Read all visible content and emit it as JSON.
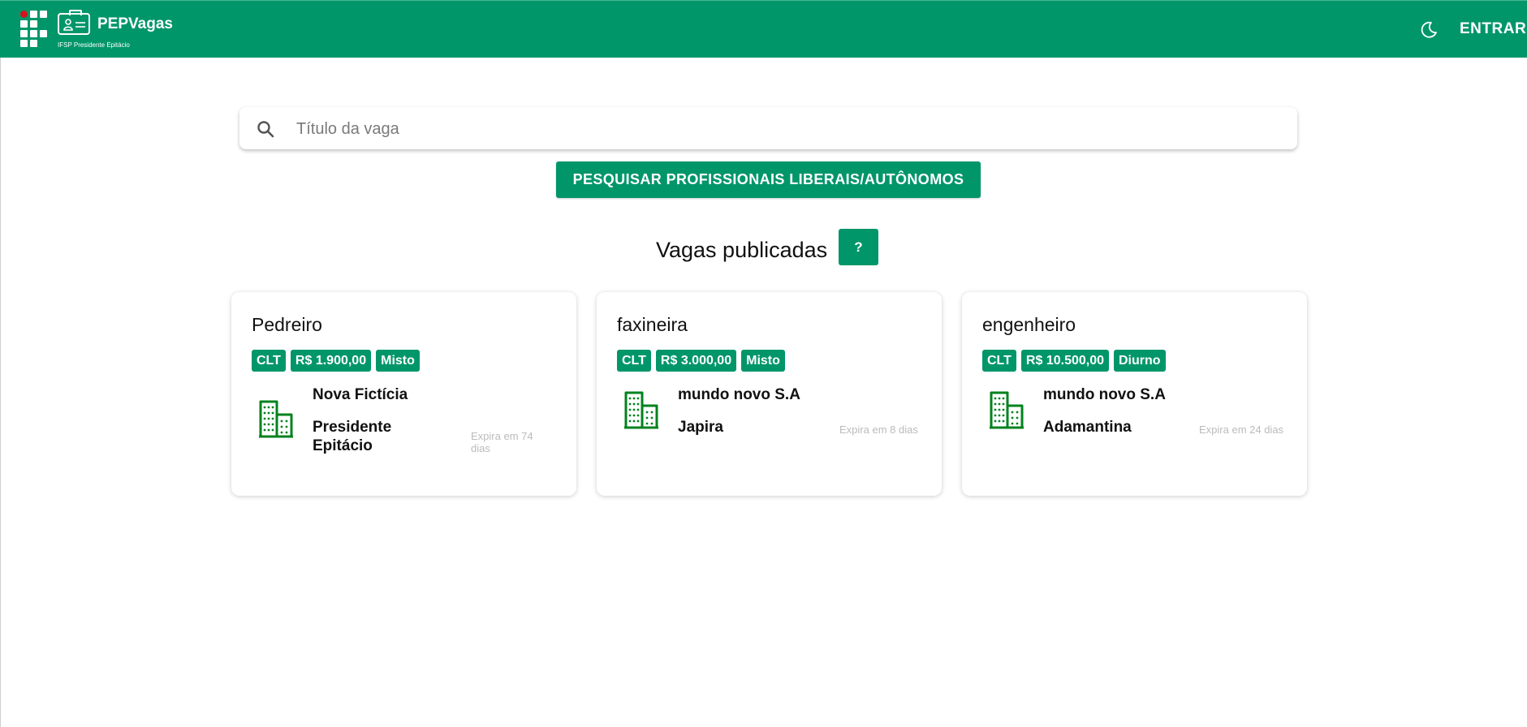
{
  "header": {
    "brand_title": "PEPVagas",
    "brand_subtitle": "IFSP Presidente Epitácio",
    "login_label": "ENTRAR",
    "theme_icon": "moon-icon"
  },
  "search": {
    "placeholder": "Título da vaga",
    "value": "",
    "icon": "search-icon"
  },
  "search_professionals_label": "PESQUISAR PROFISSIONAIS LIBERAIS/AUTÔNOMOS",
  "section": {
    "title": "Vagas publicadas",
    "help_label": "?"
  },
  "colors": {
    "brand": "#009669",
    "icon_green": "#00821e",
    "muted": "#bbbbbb"
  },
  "jobs": [
    {
      "title": "Pedreiro",
      "contract": "CLT",
      "salary": "R$ 1.900,00",
      "shift": "Misto",
      "company": "Nova Fictícia",
      "city": "Presidente Epitácio",
      "expires": "Expira em 74 dias",
      "icon": "building-icon"
    },
    {
      "title": "faxineira",
      "contract": "CLT",
      "salary": "R$ 3.000,00",
      "shift": "Misto",
      "company": "mundo novo S.A",
      "city": "Japira",
      "expires": "Expira em 8 dias",
      "icon": "building-icon"
    },
    {
      "title": "engenheiro",
      "contract": "CLT",
      "salary": "R$ 10.500,00",
      "shift": "Diurno",
      "company": "mundo novo S.A",
      "city": "Adamantina",
      "expires": "Expira em 24 dias",
      "icon": "building-icon"
    }
  ]
}
